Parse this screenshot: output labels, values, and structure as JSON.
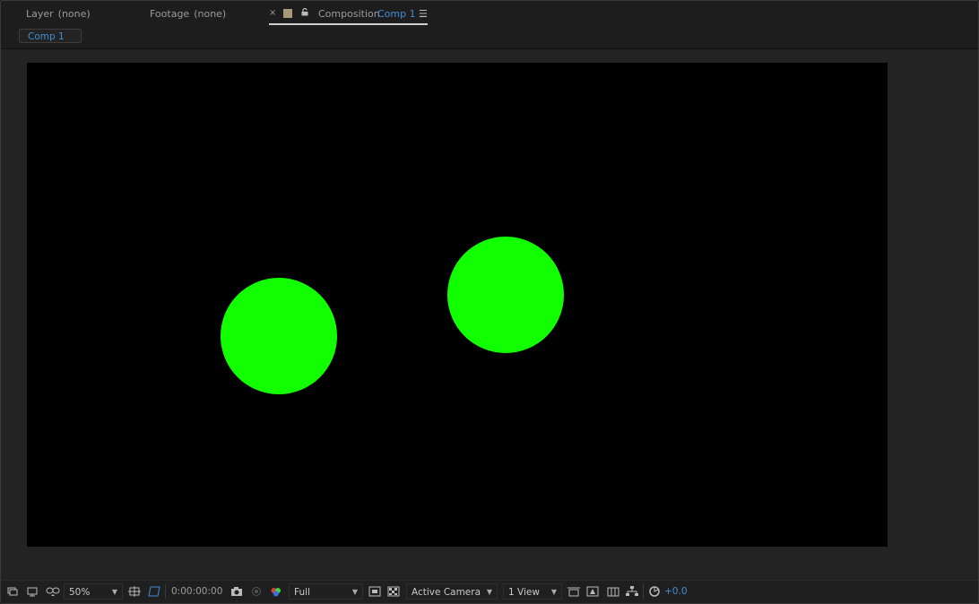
{
  "tabs": {
    "layer": {
      "label": "Layer",
      "value": "(none)"
    },
    "footage": {
      "label": "Footage",
      "value": "(none)"
    },
    "composition": {
      "close": "×",
      "label": "Composition",
      "name": "Comp 1",
      "menu": "☰"
    }
  },
  "subtab": {
    "label": "Comp 1"
  },
  "canvas": {
    "background": "#000000",
    "shapes": [
      {
        "type": "circle",
        "color": "#11ff00"
      },
      {
        "type": "circle",
        "color": "#11ff00"
      }
    ]
  },
  "toolbar": {
    "zoom": "50%",
    "timecode": "0:00:00:00",
    "resolution": "Full",
    "camera": "Active Camera",
    "views": "1 View",
    "exposure": "+0.0",
    "icons": [
      "always-preview-icon",
      "monitor-icon",
      "mask-visibility-icon",
      "grid-guides-icon",
      "region-of-interest-icon",
      "snapshot-camera-icon",
      "show-snapshot-icon",
      "color-channels-icon",
      "fast-preview-icon",
      "transparency-grid-icon",
      "3d-view-icon",
      "timeline-icon",
      "comp-flowchart-icon",
      "flowchart-icon",
      "reset-exposure-icon"
    ]
  },
  "colors": {
    "accent": "#3d8ed6",
    "shape_fill": "#11ff00",
    "panel_bg": "#232323"
  }
}
